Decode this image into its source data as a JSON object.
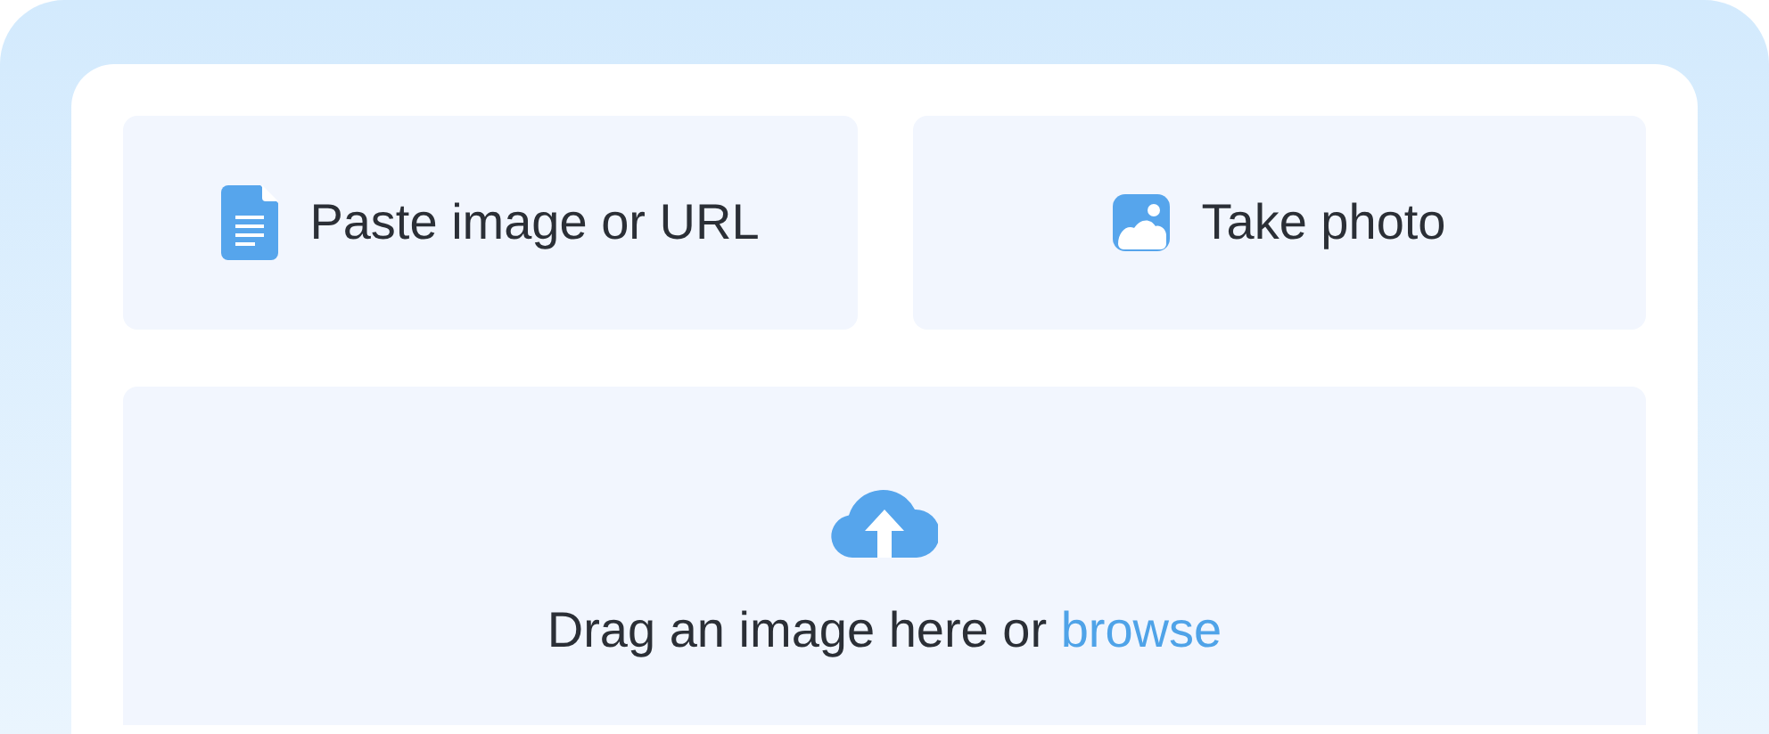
{
  "options": [
    {
      "kind": "paste",
      "label": "Paste image or URL"
    },
    {
      "kind": "photo",
      "label": "Take photo"
    }
  ],
  "dropzone": {
    "text": "Drag an image here or",
    "link": "browse"
  }
}
